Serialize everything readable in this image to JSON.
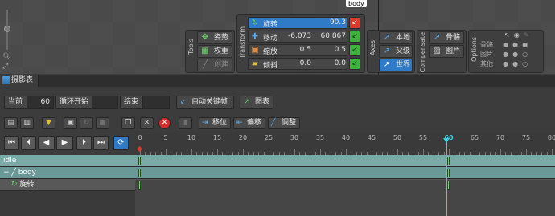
{
  "viewport": {
    "bone_label": "body",
    "zoom_icons": [
      "magnify-icon",
      "fit-icon"
    ]
  },
  "tools": {
    "title": "Tools",
    "pose": "姿势",
    "weights": "权重",
    "create": "创建"
  },
  "transform": {
    "title": "Transform",
    "rows": [
      {
        "name": "旋转",
        "v1": "",
        "v2": "90.3"
      },
      {
        "name": "移动",
        "v1": "-6.073",
        "v2": "60.867"
      },
      {
        "name": "缩放",
        "v1": "0.5",
        "v2": "0.5"
      },
      {
        "name": "倾斜",
        "v1": "0.0",
        "v2": "0.0"
      }
    ]
  },
  "axes": {
    "title": "Axes",
    "local": "本地",
    "parent": "父级",
    "world": "世界"
  },
  "compensate": {
    "title": "Compensate",
    "bones": "骨骼",
    "images": "图片"
  },
  "options": {
    "title": "Options",
    "rows": [
      "骨骼",
      "图片",
      "其他"
    ]
  },
  "dopesheet": {
    "tab": "摄影表",
    "current_label": "当前",
    "current_value": "60",
    "loop_start_label": "循环开始",
    "loop_start_value": "",
    "end_label": "结束",
    "end_value": "",
    "auto_key": "自动关键帧",
    "graph": "图表",
    "offset_label": "移位",
    "shift_label": "偏移",
    "adjust_label": "调整"
  },
  "timeline": {
    "current_frame": 60,
    "ruler_labels": [
      "0",
      "5",
      "10",
      "15",
      "20",
      "25",
      "30",
      "35",
      "40",
      "45",
      "50",
      "55",
      "60",
      "65",
      "70",
      "75",
      "80"
    ],
    "rows": [
      {
        "label": "idle",
        "keys": [
          0,
          60
        ]
      },
      {
        "label": "body",
        "keys": [
          0,
          60
        ]
      },
      {
        "label": "旋转",
        "keys": [
          0,
          60
        ]
      }
    ]
  },
  "colors": {
    "accent": "#2f7bc8",
    "key_green": "#5be05b",
    "playhead": "#3ad0e0",
    "row_teal": "#7aa9a8"
  }
}
